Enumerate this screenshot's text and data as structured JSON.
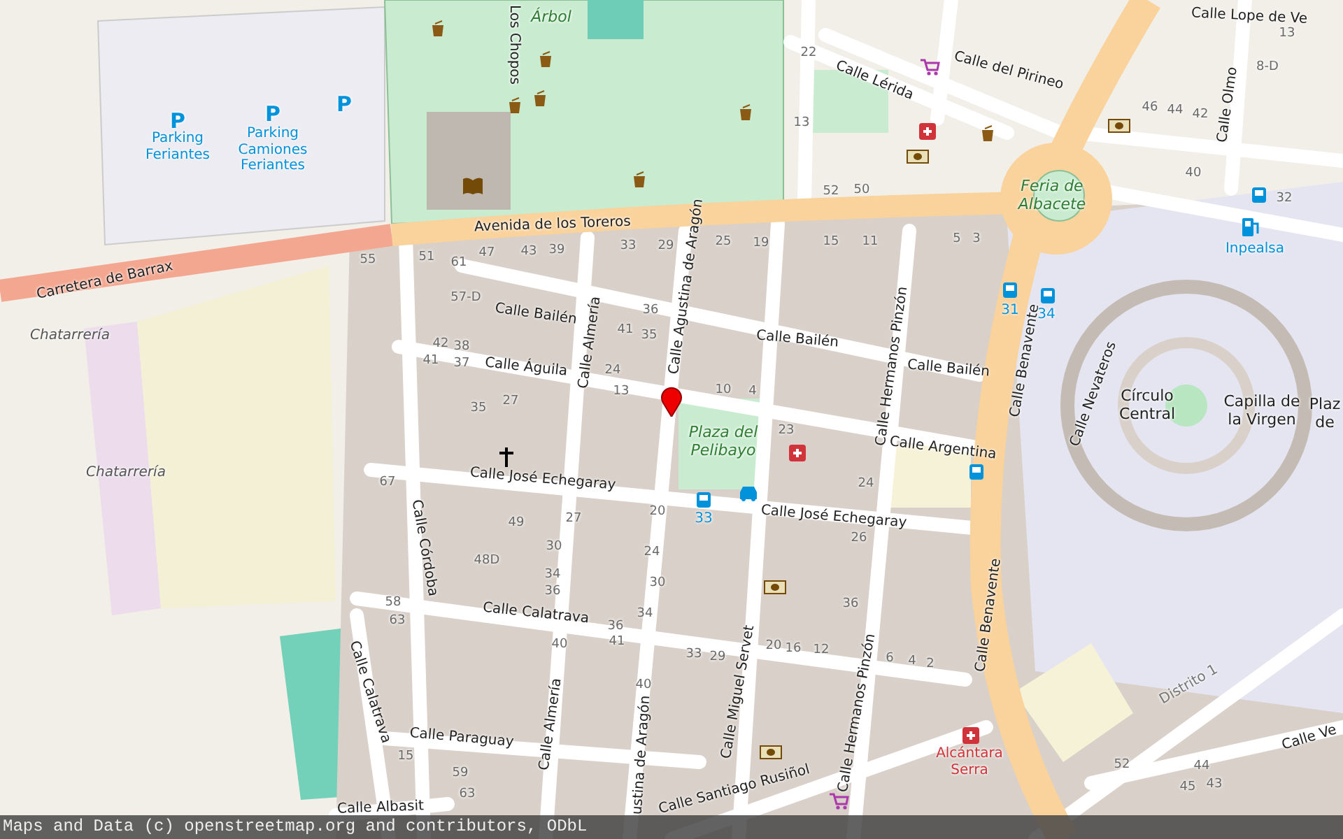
{
  "map": {
    "labels": [
      {
        "text": "Avenida de los Toreros",
        "kind": "street"
      },
      {
        "text": "Carretera de Barrax",
        "kind": "street"
      },
      {
        "text": "Calle Bailén",
        "kind": "street"
      },
      {
        "text": "Calle Bailén",
        "kind": "street"
      },
      {
        "text": "Calle Bailén",
        "kind": "street"
      },
      {
        "text": "Calle Águila",
        "kind": "street"
      },
      {
        "text": "Calle Almería",
        "kind": "street"
      },
      {
        "text": "Calle Agustina de Aragón",
        "kind": "street"
      },
      {
        "text": "Calle José Echegaray",
        "kind": "street"
      },
      {
        "text": "Calle José Echegaray",
        "kind": "street"
      },
      {
        "text": "Calle Argentina",
        "kind": "street"
      },
      {
        "text": "Calle Hermanos Pinzón",
        "kind": "street"
      },
      {
        "text": "Calle Benavente",
        "kind": "street"
      },
      {
        "text": "Calle Benavente",
        "kind": "street"
      },
      {
        "text": "Calle Nevateros",
        "kind": "street"
      },
      {
        "text": "Calle Lérida",
        "kind": "street"
      },
      {
        "text": "Calle del Pirineo",
        "kind": "street"
      },
      {
        "text": "Calle Olmo",
        "kind": "street"
      },
      {
        "text": "Calle Lope de Ve",
        "kind": "street"
      },
      {
        "text": "Calle Córdoba",
        "kind": "street"
      },
      {
        "text": "Calle Calatrava",
        "kind": "street"
      },
      {
        "text": "Calle Calatrava",
        "kind": "street"
      },
      {
        "text": "Calle Almería",
        "kind": "street"
      },
      {
        "text": "ustina de Aragón",
        "kind": "street"
      },
      {
        "text": "Calle Miguel Servet",
        "kind": "street"
      },
      {
        "text": "Calle Hermanos Pinzón",
        "kind": "street"
      },
      {
        "text": "Calle Paraguay",
        "kind": "street"
      },
      {
        "text": "Calle Albasit",
        "kind": "street"
      },
      {
        "text": "Calle Santiago Rusiñol",
        "kind": "street"
      },
      {
        "text": "Calle Ve",
        "kind": "street"
      },
      {
        "text": "Los Chopos",
        "kind": "street"
      },
      {
        "text": "Distrito 1",
        "kind": "district"
      },
      {
        "text": "Árbol",
        "kind": "park"
      },
      {
        "text": "Plaza del Pelibayo",
        "kind": "park"
      },
      {
        "text": "Feria de Albacete",
        "kind": "park"
      },
      {
        "text": "Chatarrería",
        "kind": "landuse"
      },
      {
        "text": "Chatarrería",
        "kind": "landuse"
      },
      {
        "text": "Círculo Central",
        "kind": "place"
      },
      {
        "text": "Capilla de la Virgen",
        "kind": "place"
      },
      {
        "text": "Plaz de",
        "kind": "place"
      },
      {
        "text": "P",
        "kind": "parking-sign"
      },
      {
        "text": "Parking Feriantes",
        "kind": "parking"
      },
      {
        "text": "P",
        "kind": "parking-sign"
      },
      {
        "text": "Parking Camiones Feriantes",
        "kind": "parking"
      },
      {
        "text": "P",
        "kind": "parking-sign"
      },
      {
        "text": "Inpealsa",
        "kind": "fuel"
      },
      {
        "text": "Alcántara Serra",
        "kind": "pharmacy"
      },
      {
        "text": "31",
        "kind": "bus"
      },
      {
        "text": "34",
        "kind": "bus"
      },
      {
        "text": "33",
        "kind": "bus"
      },
      {
        "text": "55",
        "kind": "number"
      },
      {
        "text": "51",
        "kind": "number"
      },
      {
        "text": "61",
        "kind": "number"
      },
      {
        "text": "47",
        "kind": "number"
      },
      {
        "text": "43",
        "kind": "number"
      },
      {
        "text": "39",
        "kind": "number"
      },
      {
        "text": "33",
        "kind": "number"
      },
      {
        "text": "29",
        "kind": "number"
      },
      {
        "text": "25",
        "kind": "number"
      },
      {
        "text": "19",
        "kind": "number"
      },
      {
        "text": "15",
        "kind": "number"
      },
      {
        "text": "11",
        "kind": "number"
      },
      {
        "text": "5",
        "kind": "number"
      },
      {
        "text": "3",
        "kind": "number"
      },
      {
        "text": "57-D",
        "kind": "number"
      },
      {
        "text": "36",
        "kind": "number"
      },
      {
        "text": "41",
        "kind": "number"
      },
      {
        "text": "35",
        "kind": "number"
      },
      {
        "text": "42",
        "kind": "number"
      },
      {
        "text": "38",
        "kind": "number"
      },
      {
        "text": "41",
        "kind": "number"
      },
      {
        "text": "37",
        "kind": "number"
      },
      {
        "text": "24",
        "kind": "number"
      },
      {
        "text": "13",
        "kind": "number"
      },
      {
        "text": "27",
        "kind": "number"
      },
      {
        "text": "35",
        "kind": "number"
      },
      {
        "text": "10",
        "kind": "number"
      },
      {
        "text": "4",
        "kind": "number"
      },
      {
        "text": "23",
        "kind": "number"
      },
      {
        "text": "24",
        "kind": "number"
      },
      {
        "text": "20",
        "kind": "number"
      },
      {
        "text": "49",
        "kind": "number"
      },
      {
        "text": "48D",
        "kind": "number"
      },
      {
        "text": "30",
        "kind": "number"
      },
      {
        "text": "34",
        "kind": "number"
      },
      {
        "text": "36",
        "kind": "number"
      },
      {
        "text": "27",
        "kind": "number"
      },
      {
        "text": "24",
        "kind": "number"
      },
      {
        "text": "30",
        "kind": "number"
      },
      {
        "text": "34",
        "kind": "number"
      },
      {
        "text": "36",
        "kind": "number"
      },
      {
        "text": "40",
        "kind": "number"
      },
      {
        "text": "41",
        "kind": "number"
      },
      {
        "text": "40",
        "kind": "number"
      },
      {
        "text": "33",
        "kind": "number"
      },
      {
        "text": "29",
        "kind": "number"
      },
      {
        "text": "20",
        "kind": "number"
      },
      {
        "text": "16",
        "kind": "number"
      },
      {
        "text": "12",
        "kind": "number"
      },
      {
        "text": "36",
        "kind": "number"
      },
      {
        "text": "26",
        "kind": "number"
      },
      {
        "text": "6",
        "kind": "number"
      },
      {
        "text": "4",
        "kind": "number"
      },
      {
        "text": "2",
        "kind": "number"
      },
      {
        "text": "22",
        "kind": "number"
      },
      {
        "text": "13",
        "kind": "number"
      },
      {
        "text": "52",
        "kind": "number"
      },
      {
        "text": "50",
        "kind": "number"
      },
      {
        "text": "46",
        "kind": "number"
      },
      {
        "text": "44",
        "kind": "number"
      },
      {
        "text": "42",
        "kind": "number"
      },
      {
        "text": "40",
        "kind": "number"
      },
      {
        "text": "32",
        "kind": "number"
      },
      {
        "text": "8-D",
        "kind": "number"
      },
      {
        "text": "13",
        "kind": "number"
      },
      {
        "text": "67",
        "kind": "number"
      },
      {
        "text": "58",
        "kind": "number"
      },
      {
        "text": "63",
        "kind": "number"
      },
      {
        "text": "15",
        "kind": "number"
      },
      {
        "text": "59",
        "kind": "number"
      },
      {
        "text": "63",
        "kind": "number"
      },
      {
        "text": "52",
        "kind": "number"
      },
      {
        "text": "44",
        "kind": "number"
      },
      {
        "text": "45",
        "kind": "number"
      },
      {
        "text": "43",
        "kind": "number"
      }
    ]
  },
  "attribution": "Maps and Data (c) openstreetmap.org and contributors, ODbL"
}
